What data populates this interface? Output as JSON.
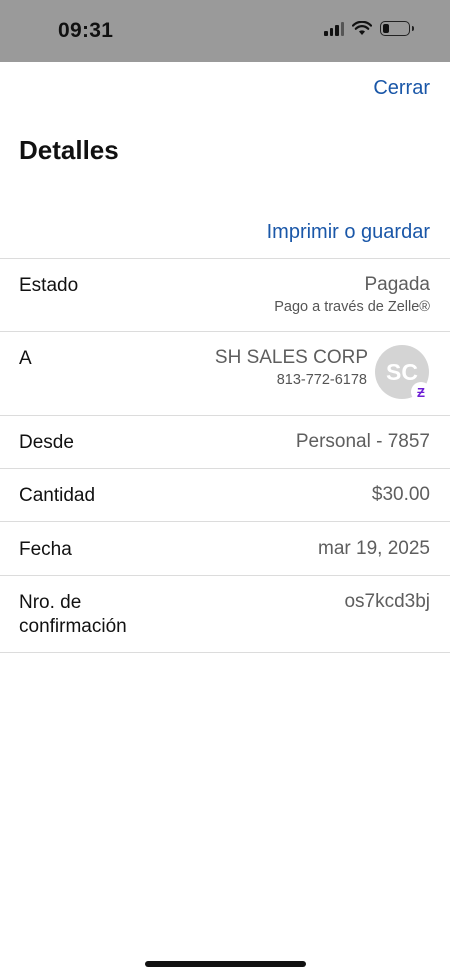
{
  "status_bar": {
    "time": "09:31"
  },
  "header": {
    "close_label": "Cerrar",
    "title": "Detalles"
  },
  "actions": {
    "print_label": "Imprimir o guardar"
  },
  "details": {
    "estado": {
      "label": "Estado",
      "value": "Pagada",
      "sub": "Pago a través de Zelle®"
    },
    "a": {
      "label": "A",
      "value": "SH SALES CORP",
      "sub": "813-772-6178",
      "avatar_initials": "SC",
      "badge_glyph": "Ƶ"
    },
    "desde": {
      "label": "Desde",
      "value": "Personal - 7857"
    },
    "cantidad": {
      "label": "Cantidad",
      "value": "$30.00"
    },
    "fecha": {
      "label": "Fecha",
      "value": "mar 19, 2025"
    },
    "confirmacion": {
      "label_line1": "Nro. de",
      "label_line2": "confirmación",
      "value": "os7kcd3bj"
    }
  },
  "colors": {
    "link": "#1a57a8",
    "status_bar": "#9a9a9a",
    "zelle_purple": "#6d1ed4"
  }
}
